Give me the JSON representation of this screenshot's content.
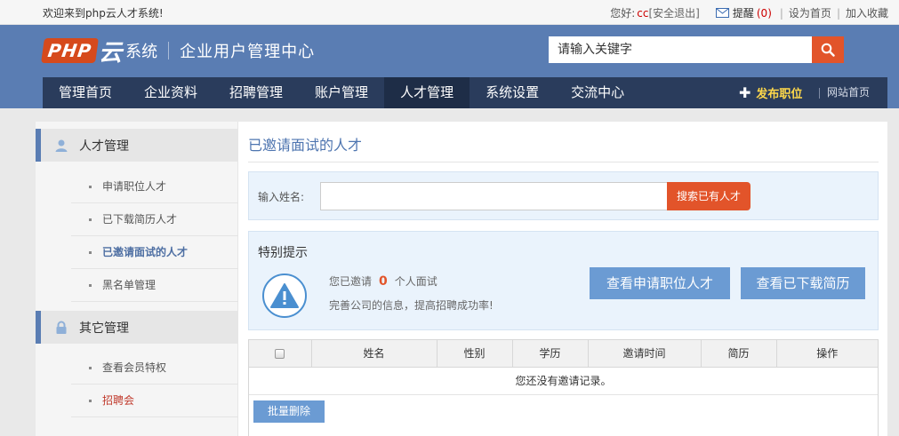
{
  "topbar": {
    "welcome": "欢迎来到php云人才系统!",
    "greeting": "您好:",
    "username": "cc",
    "logout": "[安全退出]",
    "remind_label": "提醒",
    "remind_count": "(0)",
    "set_home": "设为首页",
    "add_fav": "加入收藏"
  },
  "header": {
    "logo_php": "PHP",
    "logo_yun": "云",
    "logo_sys": "系统",
    "center_title": "企业用户管理中心",
    "search_placeholder": "请输入关键字"
  },
  "nav": {
    "items": [
      "管理首页",
      "企业资料",
      "招聘管理",
      "账户管理",
      "人才管理",
      "系统设置",
      "交流中心"
    ],
    "active_index": 4,
    "publish": "发布职位",
    "site_home": "网站首页"
  },
  "sidebar": {
    "group1_title": "人才管理",
    "group1_items": [
      "申请职位人才",
      "已下载简历人才",
      "已邀请面试的人才",
      "黑名单管理"
    ],
    "group2_title": "其它管理",
    "group2_items": [
      "查看会员特权",
      "招聘会"
    ]
  },
  "main": {
    "title": "已邀请面试的人才",
    "search_label": "输入姓名:",
    "search_button": "搜索已有人才",
    "tip_title": "特别提示",
    "invited_prefix": "您已邀请",
    "invited_count": "0",
    "invited_suffix": "个人面试",
    "tip_line2": "完善公司的信息，提高招聘成功率!",
    "btn_applied": "查看申请职位人才",
    "btn_downloaded": "查看已下载简历"
  },
  "table": {
    "headers": [
      "姓名",
      "性别",
      "学历",
      "邀请时间",
      "简历",
      "操作"
    ],
    "empty_text": "您还没有邀请记录。",
    "batch_delete": "批量删除"
  },
  "colors": {
    "header_bg": "#5a7db3",
    "nav_bg": "#2a3c5c",
    "accent_orange": "#e2542a",
    "button_blue": "#6b9bd3",
    "title_blue": "#4e75b0"
  }
}
